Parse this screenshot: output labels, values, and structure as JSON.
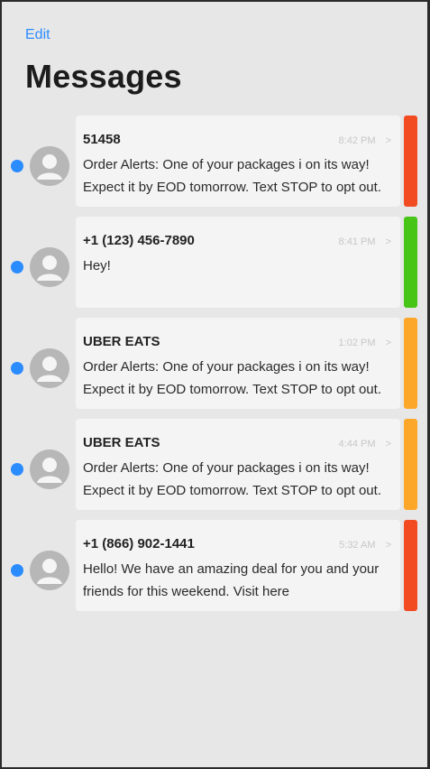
{
  "header": {
    "edit_label": "Edit",
    "title": "Messages"
  },
  "colors": {
    "accent": "#2b8cff",
    "status_red": "#f24a21",
    "status_green": "#46c516",
    "status_orange": "#fca72a"
  },
  "messages": [
    {
      "sender": "51458",
      "time": "8:42 PM",
      "preview": "Order Alerts: One of your packages i on its way! Expect it by EOD tomorrow. Text STOP to opt out.",
      "unread": true,
      "status": "red"
    },
    {
      "sender": "+1 (123) 456-7890",
      "time": "8:41 PM",
      "preview": "Hey!",
      "unread": true,
      "status": "green"
    },
    {
      "sender": "UBER EATS",
      "time": "1:02 PM",
      "preview": "Order Alerts: One of your packages i on its way! Expect it by EOD tomorrow. Text STOP to opt out.",
      "unread": true,
      "status": "orange"
    },
    {
      "sender": "UBER EATS",
      "time": "4:44 PM",
      "preview": "Order Alerts: One of your packages i on its way! Expect it by EOD tomorrow. Text STOP to opt out.",
      "unread": true,
      "status": "orange"
    },
    {
      "sender": "+1 (866) 902-1441",
      "time": "5:32 AM",
      "preview": "Hello! We have an amazing deal for you and your friends for this weekend. Visit here",
      "unread": true,
      "status": "red"
    }
  ],
  "icons": {
    "avatar": "person-silhouette-icon",
    "chevron": "chevron-right-icon",
    "chevron_glyph": ">"
  }
}
